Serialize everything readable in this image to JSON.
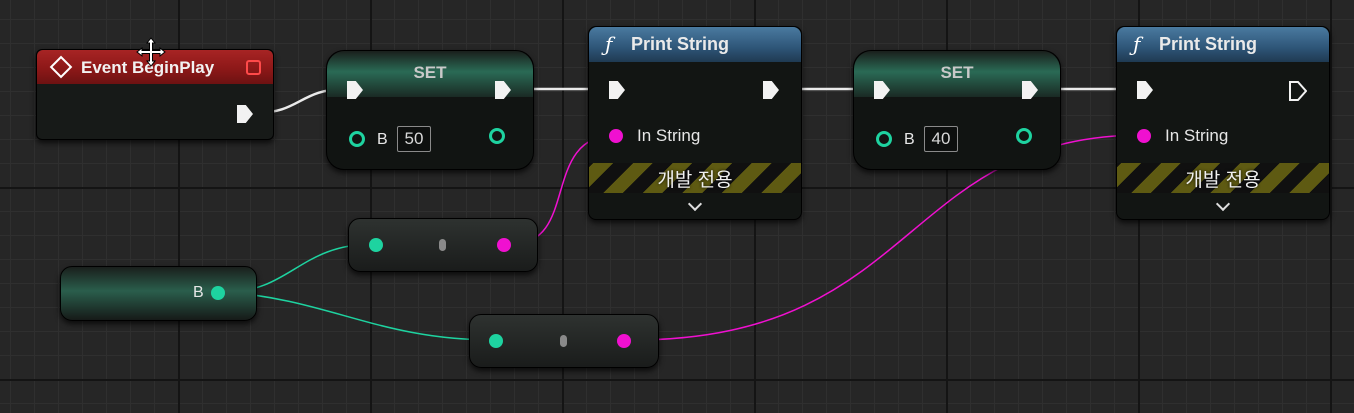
{
  "event_node": {
    "title": "Event BeginPlay"
  },
  "set_nodes": [
    {
      "title": "SET",
      "var_label": "B",
      "value": "50"
    },
    {
      "title": "SET",
      "var_label": "B",
      "value": "40"
    }
  ],
  "print_nodes": [
    {
      "title": "Print String",
      "input_label": "In String",
      "dev_only_label": "개발 전용"
    },
    {
      "title": "Print String",
      "input_label": "In String",
      "dev_only_label": "개발 전용"
    }
  ],
  "get_node": {
    "var_label": "B"
  },
  "colors": {
    "exec": "#f2f2f2",
    "integer_pin": "#1ed3a0",
    "string_pin": "#f010d0",
    "event_header": "#8d1818",
    "function_header": "#2e5577"
  },
  "icons": [
    "event-diamond-icon",
    "stop-icon",
    "function-icon",
    "chevron-down-icon",
    "move-cursor-icon"
  ]
}
